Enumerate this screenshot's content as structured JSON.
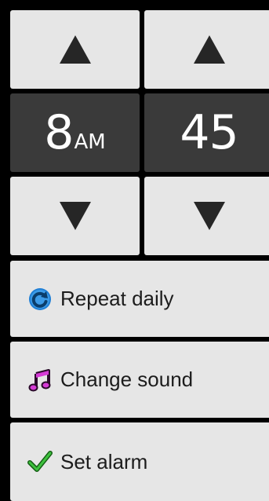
{
  "time": {
    "hour": "8",
    "meridiem": "AM",
    "minute": "45"
  },
  "controls": {
    "hour_up_icon": "triangle-up",
    "hour_down_icon": "triangle-down",
    "minute_up_icon": "triangle-up",
    "minute_down_icon": "triangle-down"
  },
  "actions": [
    {
      "label": "Repeat daily",
      "icon": "refresh-icon",
      "icon_color": "#1f7fd6"
    },
    {
      "label": "Change sound",
      "icon": "music-note-icon",
      "icon_color": "#d63ad6"
    },
    {
      "label": "Set alarm",
      "icon": "checkmark-icon",
      "icon_color": "#2aa52a"
    }
  ],
  "colors": {
    "button_bg": "#e6e6e6",
    "display_bg": "#3a3a3a",
    "frame_bg": "#000000",
    "arrow": "#262626"
  }
}
